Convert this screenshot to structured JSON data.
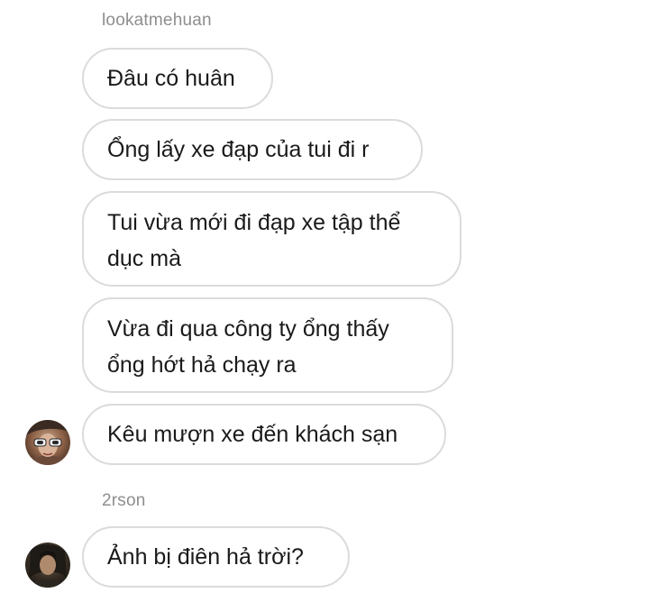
{
  "conversation": {
    "groups": [
      {
        "sender": "lookatmehuan",
        "messages": [
          {
            "lines": [
              "Đâu có huân"
            ]
          },
          {
            "lines": [
              "Ổng lấy xe đạp của tui đi r"
            ]
          },
          {
            "lines": [
              "Tui vừa mới đi đạp xe tập thể",
              "dục mà"
            ]
          },
          {
            "lines": [
              "Vừa đi qua công ty ổng thấy",
              "ổng hớt hả chạy ra"
            ]
          },
          {
            "lines": [
              "Kêu mượn xe đến khách sạn"
            ]
          }
        ],
        "avatar_icon": "user-avatar-sunglasses-icon"
      },
      {
        "sender": "2rson",
        "messages": [
          {
            "lines": [
              "Ảnh bị điên hả trời?"
            ]
          }
        ],
        "avatar_icon": "user-avatar-dark-icon"
      }
    ]
  },
  "colors": {
    "bubble_border": "#dbdbdb",
    "sender_text": "#8e8e8e",
    "message_text": "#1a1a1a",
    "background": "#ffffff"
  }
}
